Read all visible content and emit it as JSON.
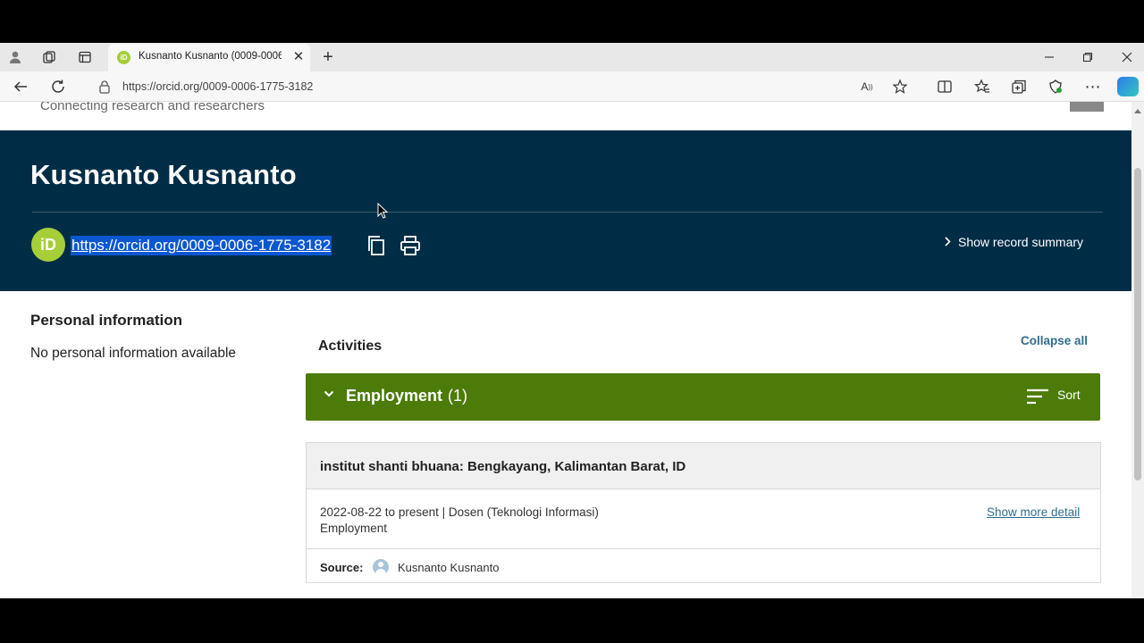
{
  "browser": {
    "tab_title": "Kusnanto Kusnanto (0009-0006-",
    "favicon_text": "iD",
    "url": "https://orcid.org/0009-0006-1775-3182"
  },
  "page": {
    "tagline": "Connecting research and researchers",
    "name": "Kusnanto Kusnanto",
    "orcid_logo": "iD",
    "orcid_url": "https://orcid.org/0009-0006-1775-3182",
    "show_record_summary": "Show record summary",
    "personal_info_title": "Personal information",
    "personal_info_text": "No personal information available",
    "activities_title": "Activities",
    "collapse_all": "Collapse all",
    "employment": {
      "title": "Employment",
      "count": "(1)",
      "sort_label": "Sort",
      "header_color": "#4c7b09",
      "item": {
        "organization": "institut shanti bhuana: Bengkayang, Kalimantan Barat, ID",
        "dates_role": "2022-08-22 to present | Dosen (Teknologi Informasi)",
        "type": "Employment",
        "show_more": "Show more detail",
        "source_label": "Source:",
        "source_name": "Kusnanto Kusnanto"
      }
    }
  },
  "colors": {
    "banner": "#002d46",
    "orcid_green": "#a6ce39",
    "link": "#2e6f8e"
  }
}
